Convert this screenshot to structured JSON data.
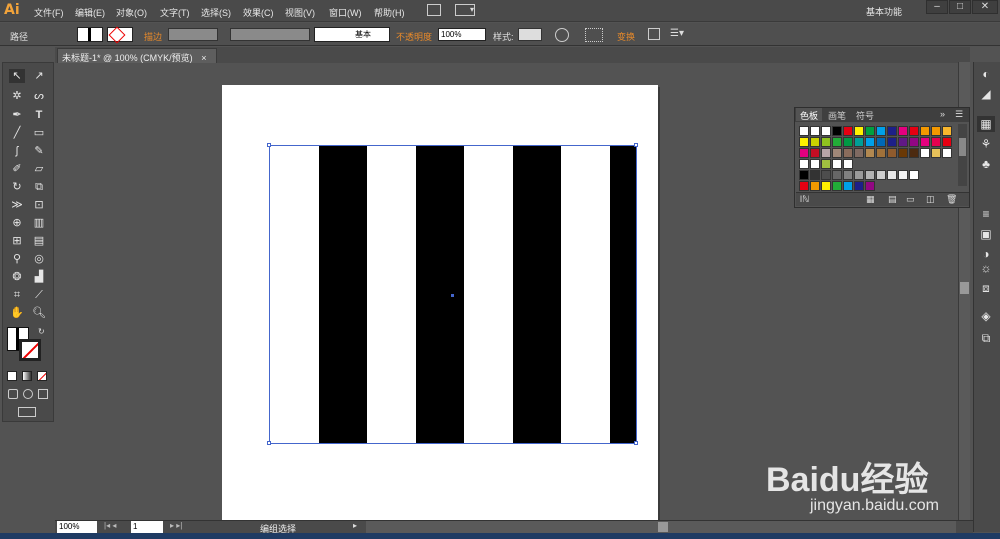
{
  "app": {
    "logo": "Ai",
    "workspace": "基本功能"
  },
  "menubar": {
    "items": [
      "文件(F)",
      "编辑(E)",
      "对象(O)",
      "文字(T)",
      "选择(S)",
      "效果(C)",
      "视图(V)",
      "窗口(W)",
      "帮助(H)"
    ],
    "window_buttons": [
      "–",
      "□",
      "✕"
    ]
  },
  "control_bar": {
    "object_type": "路径",
    "stroke_label": "描边",
    "brush_style": "基本",
    "opacity_label": "不透明度",
    "opacity_value": "100%",
    "style_label": "样式:",
    "transform_label": "变换"
  },
  "document": {
    "tab_title": "未标题-1* @ 100% (CMYK/预览)",
    "close": "×"
  },
  "canvas": {
    "stripe_count": 5,
    "colors": {
      "stripe": "#000000",
      "artboard": "#ffffff",
      "selection": "#4466cc"
    }
  },
  "swatches_panel": {
    "tabs": [
      "色板",
      "画笔",
      "符号"
    ],
    "rows": [
      [
        "#ffffff",
        "#ffffff",
        "#ffffff",
        "#000000",
        "#e60012",
        "#fff100",
        "#00a040",
        "#00a0e9",
        "#1d2088",
        "#e4007f",
        "#e60012",
        "#f39800",
        "#f39800",
        "#f8b62d"
      ],
      [
        "#fff100",
        "#c9d200",
        "#8fc31f",
        "#22ac38",
        "#009944",
        "#009e96",
        "#00a0e9",
        "#0068b7",
        "#1d2088",
        "#601986",
        "#920783",
        "#e4007f",
        "#e5004f",
        "#e60012"
      ],
      [
        "#e4007f",
        "#c30d23",
        "#b7a4a7",
        "#a08878",
        "#8a6c5c",
        "#7f6a62",
        "#b28850",
        "#a0713a",
        "#8f5b2d",
        "#6a3906",
        "#4c2a10",
        "#ffffff",
        "#e6c15a",
        "#ffffff"
      ],
      [
        "#ffffff",
        "#ffffff",
        "#a0c040",
        "#ffffff",
        "#ffffff"
      ],
      [
        "#000000",
        "#333333",
        "#4d4d4d",
        "#666666",
        "#808080",
        "#999999",
        "#b3b3b3",
        "#cccccc",
        "#e6e6e6",
        "#f2f2f2",
        "#ffffff"
      ],
      [
        "#e60012",
        "#f39800",
        "#fff100",
        "#22ac38",
        "#00a0e9",
        "#1d2088",
        "#920783"
      ]
    ]
  },
  "status_bar": {
    "zoom": "100%",
    "artboard_nav": "1",
    "status_text": "编组选择"
  },
  "watermark": {
    "brand": "Baidu经验",
    "url": "jingyan.baidu.com"
  }
}
